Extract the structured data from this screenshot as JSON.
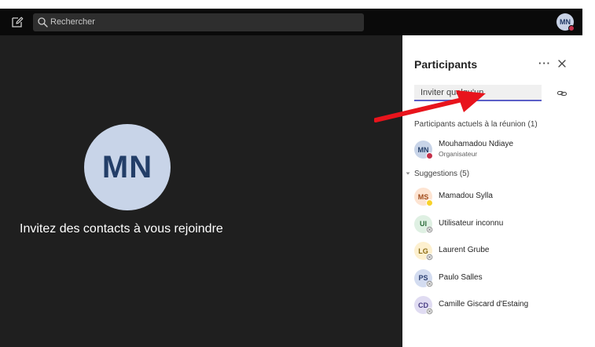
{
  "topbar": {
    "search_placeholder": "Rechercher",
    "user_initials": "MN"
  },
  "stage": {
    "avatar_initials": "MN",
    "invite_message": "Invitez des contacts à vous rejoindre"
  },
  "panel": {
    "title": "Participants",
    "more_label": "···",
    "invite_placeholder": "Inviter quelqu'un",
    "current_section": "Participants actuels à la réunion (1)",
    "current": [
      {
        "initials": "MN",
        "name": "Mouhamadou Ndiaye",
        "role": "Organisateur",
        "avatar_bg": "#c8d4e8",
        "avatar_fg": "#233e68",
        "status": "busy"
      }
    ],
    "suggestions_section": "Suggestions (5)",
    "suggestions": [
      {
        "initials": "MS",
        "name": "Mamadou Sylla",
        "avatar_bg": "#fde4d2",
        "avatar_fg": "#a14b1c",
        "status": "away"
      },
      {
        "initials": "UI",
        "name": "Utilisateur inconnu",
        "avatar_bg": "#dff0e3",
        "avatar_fg": "#2c6b3a",
        "status": "offline"
      },
      {
        "initials": "LG",
        "name": "Laurent Grube",
        "avatar_bg": "#fdf0cf",
        "avatar_fg": "#8a6a10",
        "status": "offline"
      },
      {
        "initials": "PS",
        "name": "Paulo Salles",
        "avatar_bg": "#d3dcf0",
        "avatar_fg": "#2b3f72",
        "status": "offline"
      },
      {
        "initials": "CD",
        "name": "Camille Giscard d'Estaing",
        "avatar_bg": "#e0dcf2",
        "avatar_fg": "#4a3f84",
        "status": "offline"
      }
    ]
  },
  "colors": {
    "accent": "#5b5fc7",
    "busy": "#c4314b",
    "away": "#f8d22a",
    "annotation_arrow": "#e8141c"
  }
}
